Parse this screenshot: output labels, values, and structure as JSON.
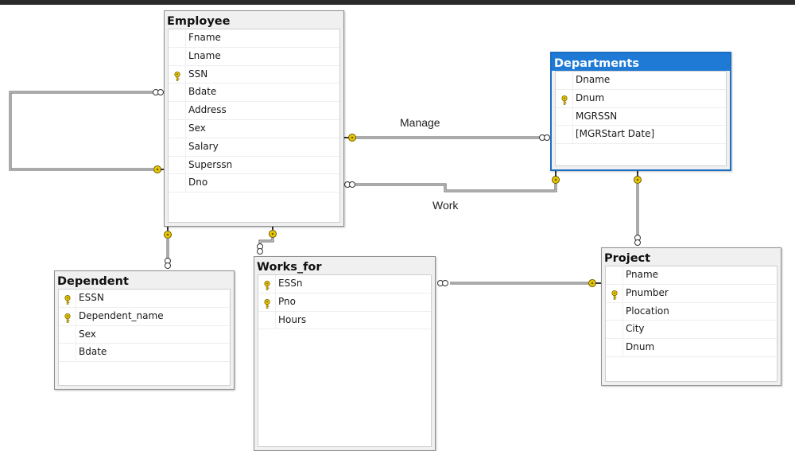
{
  "tables": {
    "employee": {
      "title": "Employee",
      "columns": [
        {
          "name": "Fname",
          "key": false
        },
        {
          "name": "Lname",
          "key": false
        },
        {
          "name": "SSN",
          "key": true
        },
        {
          "name": "Bdate",
          "key": false
        },
        {
          "name": "Address",
          "key": false
        },
        {
          "name": "Sex",
          "key": false
        },
        {
          "name": "Salary",
          "key": false
        },
        {
          "name": "Superssn",
          "key": false
        },
        {
          "name": "Dno",
          "key": false
        }
      ]
    },
    "departments": {
      "title": "Departments",
      "selected": true,
      "columns": [
        {
          "name": "Dname",
          "key": false
        },
        {
          "name": "Dnum",
          "key": true
        },
        {
          "name": "MGRSSN",
          "key": false
        },
        {
          "name": "[MGRStart Date]",
          "key": false
        }
      ]
    },
    "dependent": {
      "title": "Dependent",
      "columns": [
        {
          "name": "ESSN",
          "key": true
        },
        {
          "name": "Dependent_name",
          "key": true
        },
        {
          "name": "Sex",
          "key": false
        },
        {
          "name": "Bdate",
          "key": false
        }
      ]
    },
    "works_for": {
      "title": "Works_for",
      "columns": [
        {
          "name": "ESSn",
          "key": true
        },
        {
          "name": "Pno",
          "key": true
        },
        {
          "name": "Hours",
          "key": false
        }
      ]
    },
    "project": {
      "title": "Project",
      "columns": [
        {
          "name": "Pname",
          "key": false
        },
        {
          "name": "Pnumber",
          "key": true
        },
        {
          "name": "Plocation",
          "key": false
        },
        {
          "name": "City",
          "key": false
        },
        {
          "name": "Dnum",
          "key": false
        }
      ]
    }
  },
  "relationships": {
    "manage_label": "Manage",
    "work_label": "Work"
  },
  "colors": {
    "key_icon": "#e8c800",
    "selected_header": "#1f7ad6",
    "line": "#555555"
  }
}
